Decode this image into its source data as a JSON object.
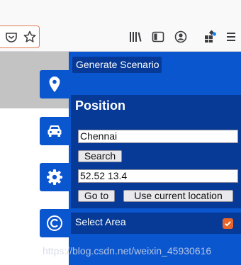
{
  "browser": {
    "toolbar_icons": [
      "pocket-icon",
      "bookmark-star-icon",
      "library-icon",
      "sidebar-icon",
      "account-icon",
      "extensions-icon",
      "menu-icon"
    ]
  },
  "side_tabs": [
    {
      "icon": "map-marker-icon",
      "active": true
    },
    {
      "icon": "car-icon",
      "active": false
    },
    {
      "icon": "gear-icon",
      "active": false
    },
    {
      "icon": "copyright-icon",
      "active": false
    }
  ],
  "panel": {
    "generate_label": "Generate Scenario",
    "position_title": "Position",
    "search_value": "Chennai",
    "search_button": "Search",
    "coords_value": "52.52 13.4",
    "goto_button": "Go to",
    "current_location_button": "Use current location",
    "select_area_label": "Select Area",
    "select_area_checked": true
  },
  "watermark": "https://blog.csdn.net/weixin_45930616",
  "colors": {
    "panel_blue": "#0a56cf",
    "dark_blue": "#063a96",
    "checkbox_orange": "#e8652c",
    "page_gray": "#c3c3c3"
  }
}
